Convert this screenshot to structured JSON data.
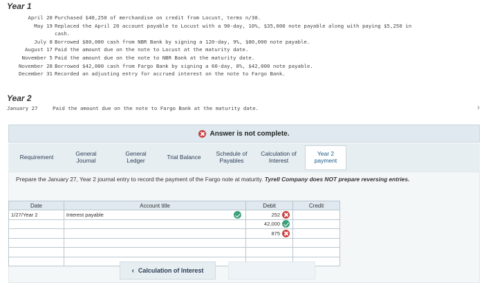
{
  "year1": {
    "title": "Year 1",
    "transactions": [
      {
        "date": "April 20",
        "desc": "Purchased $40,250 of merchandise on credit from Locust, terms n/30."
      },
      {
        "date": "May 19",
        "desc": "Replaced the April 20 account payable to Locust with a 90-day, 10%, $35,000 note payable along with paying $5,250 in"
      },
      {
        "date": "",
        "desc": "cash."
      },
      {
        "date": "July 8",
        "desc": "Borrowed $80,000 cash from NBR Bank by signing a 120-day, 9%, $80,000 note payable."
      },
      {
        "date": "August 17",
        "desc": "Paid the amount due on the note to Locust at the maturity date."
      },
      {
        "date": "November 5",
        "desc": "Paid the amount due on the note to NBR Bank at the maturity date."
      },
      {
        "date": "November 28",
        "desc": "Borrowed $42,000 cash from Fargo Bank by signing a 60-day, 8%, $42,000 note payable."
      },
      {
        "date": "December 31",
        "desc": "Recorded an adjusting entry for accrued interest on the note to Fargo Bank."
      }
    ]
  },
  "year2": {
    "title": "Year 2",
    "transactions": [
      {
        "date": "January 27",
        "desc": "Paid the amount due on the note to Fargo Bank at the maturity date."
      }
    ]
  },
  "banner": {
    "text": "Answer is not complete.",
    "icon": "x-circle-icon",
    "color": "#c94040"
  },
  "tabs": [
    {
      "line1": "Requirement",
      "line2": ""
    },
    {
      "line1": "General",
      "line2": "Journal"
    },
    {
      "line1": "General",
      "line2": "Ledger"
    },
    {
      "line1": "Trial Balance",
      "line2": ""
    },
    {
      "line1": "Schedule of",
      "line2": "Payables"
    },
    {
      "line1": "Calculation of",
      "line2": "Interest"
    },
    {
      "line1": "Year 2",
      "line2": "payment"
    }
  ],
  "instructions": {
    "text": "Prepare the January 27, Year 2 journal entry to record the payment of the Fargo note at maturity.",
    "emphasis": "Tyrell Company does NOT prepare reversing entries."
  },
  "journal": {
    "headers": {
      "date": "Date",
      "account": "Account title",
      "debit": "Debit",
      "credit": "Credit"
    },
    "rows": [
      {
        "date": "1/27/Year 2",
        "account": "Interest payable",
        "account_status": "correct",
        "debit": "252",
        "debit_status": "incorrect",
        "credit": "",
        "credit_status": ""
      },
      {
        "date": "",
        "account": "",
        "account_status": "",
        "debit": "42,000",
        "debit_status": "correct",
        "credit": "",
        "credit_status": ""
      },
      {
        "date": "",
        "account": "",
        "account_status": "",
        "debit": "875",
        "debit_status": "incorrect",
        "credit": "",
        "credit_status": ""
      },
      {
        "date": "",
        "account": "",
        "account_status": "",
        "debit": "",
        "debit_status": "",
        "credit": "",
        "credit_status": ""
      },
      {
        "date": "",
        "account": "",
        "account_status": "",
        "debit": "",
        "debit_status": "",
        "credit": "",
        "credit_status": ""
      },
      {
        "date": "",
        "account": "",
        "account_status": "",
        "debit": "",
        "debit_status": "",
        "credit": "",
        "credit_status": ""
      }
    ]
  },
  "nav": {
    "prev_label": "Calculation of Interest",
    "next_label": ""
  },
  "colors": {
    "accent": "#1a5a8a",
    "correct": "#3ba07a",
    "incorrect": "#c94040",
    "banner_bg": "#dfe9ef"
  }
}
